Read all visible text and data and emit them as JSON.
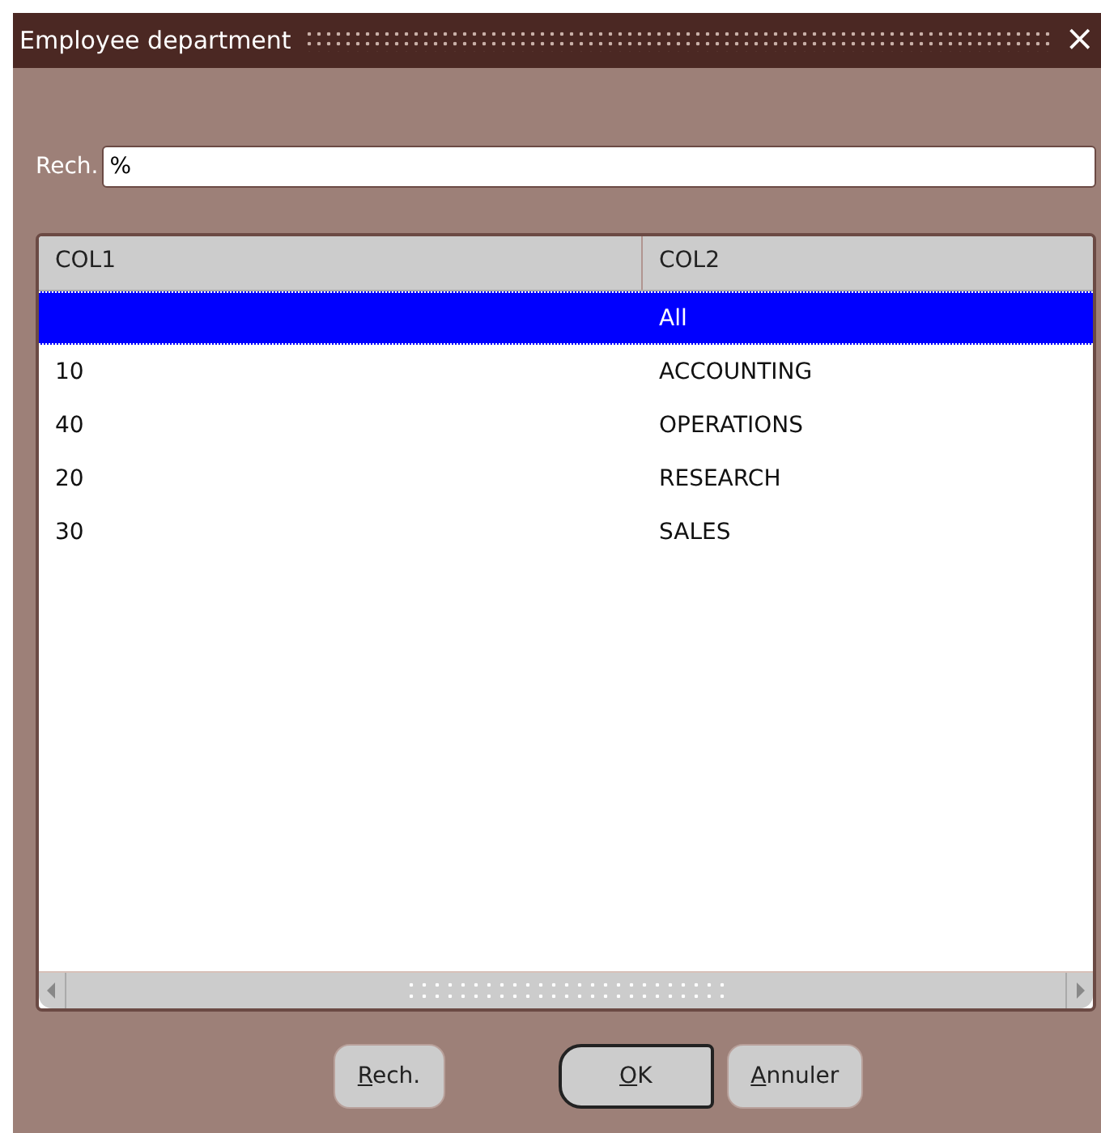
{
  "window": {
    "title": "Employee department",
    "close": "×"
  },
  "search": {
    "label": "Rech.",
    "value": "%"
  },
  "table": {
    "columns": [
      "COL1",
      "COL2"
    ],
    "rows": [
      {
        "cells": [
          "",
          "All"
        ],
        "selected": true
      },
      {
        "cells": [
          "10",
          "ACCOUNTING"
        ],
        "selected": false
      },
      {
        "cells": [
          "40",
          "OPERATIONS"
        ],
        "selected": false
      },
      {
        "cells": [
          "20",
          "RESEARCH"
        ],
        "selected": false
      },
      {
        "cells": [
          "30",
          "SALES"
        ],
        "selected": false
      }
    ]
  },
  "buttons": [
    {
      "label": "Rech.",
      "first_letter_underlined": true,
      "default": false
    },
    {
      "label": "OK",
      "first_letter_underlined": true,
      "default": true
    },
    {
      "label": "Annuler",
      "first_letter_underlined": true,
      "default": false
    }
  ]
}
